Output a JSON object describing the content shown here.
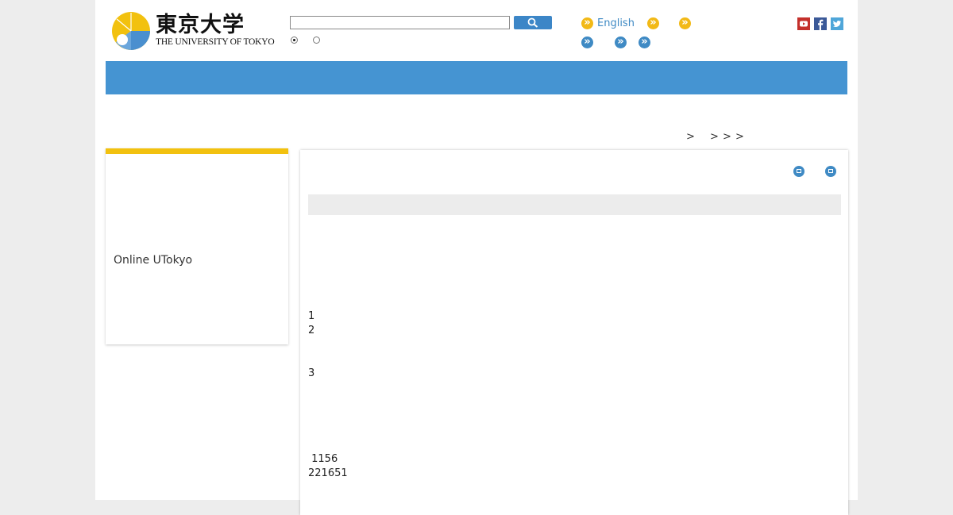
{
  "header": {
    "logo_jp": "東京大学",
    "logo_en": "THE UNIVERSITY OF TOKYO",
    "search": {
      "value": "",
      "placeholder": ""
    },
    "utility_links": [
      {
        "label": "English",
        "color": "#f2b916"
      },
      {
        "label": "",
        "color": "#f2b916"
      },
      {
        "label": "",
        "color": "#f2b916"
      },
      {
        "label": "",
        "color": "#3f8ac4"
      },
      {
        "label": "",
        "color": "#3f8ac4"
      },
      {
        "label": "",
        "color": "#3f8ac4"
      }
    ],
    "social_icons": [
      "youtube-icon",
      "facebook-icon",
      "twitter-icon"
    ]
  },
  "colors": {
    "nav_bar": "#4594d2",
    "accent_yellow": "#f2c10f",
    "link_blue": "#3f8ac4"
  },
  "breadcrumb": {
    "separators": [
      ">",
      ">",
      ">",
      ">"
    ]
  },
  "sidebar": {
    "link": "Online UTokyo"
  },
  "content": {
    "lines": [
      "1",
      "2",
      "3",
      " 1156",
      "221651"
    ]
  }
}
